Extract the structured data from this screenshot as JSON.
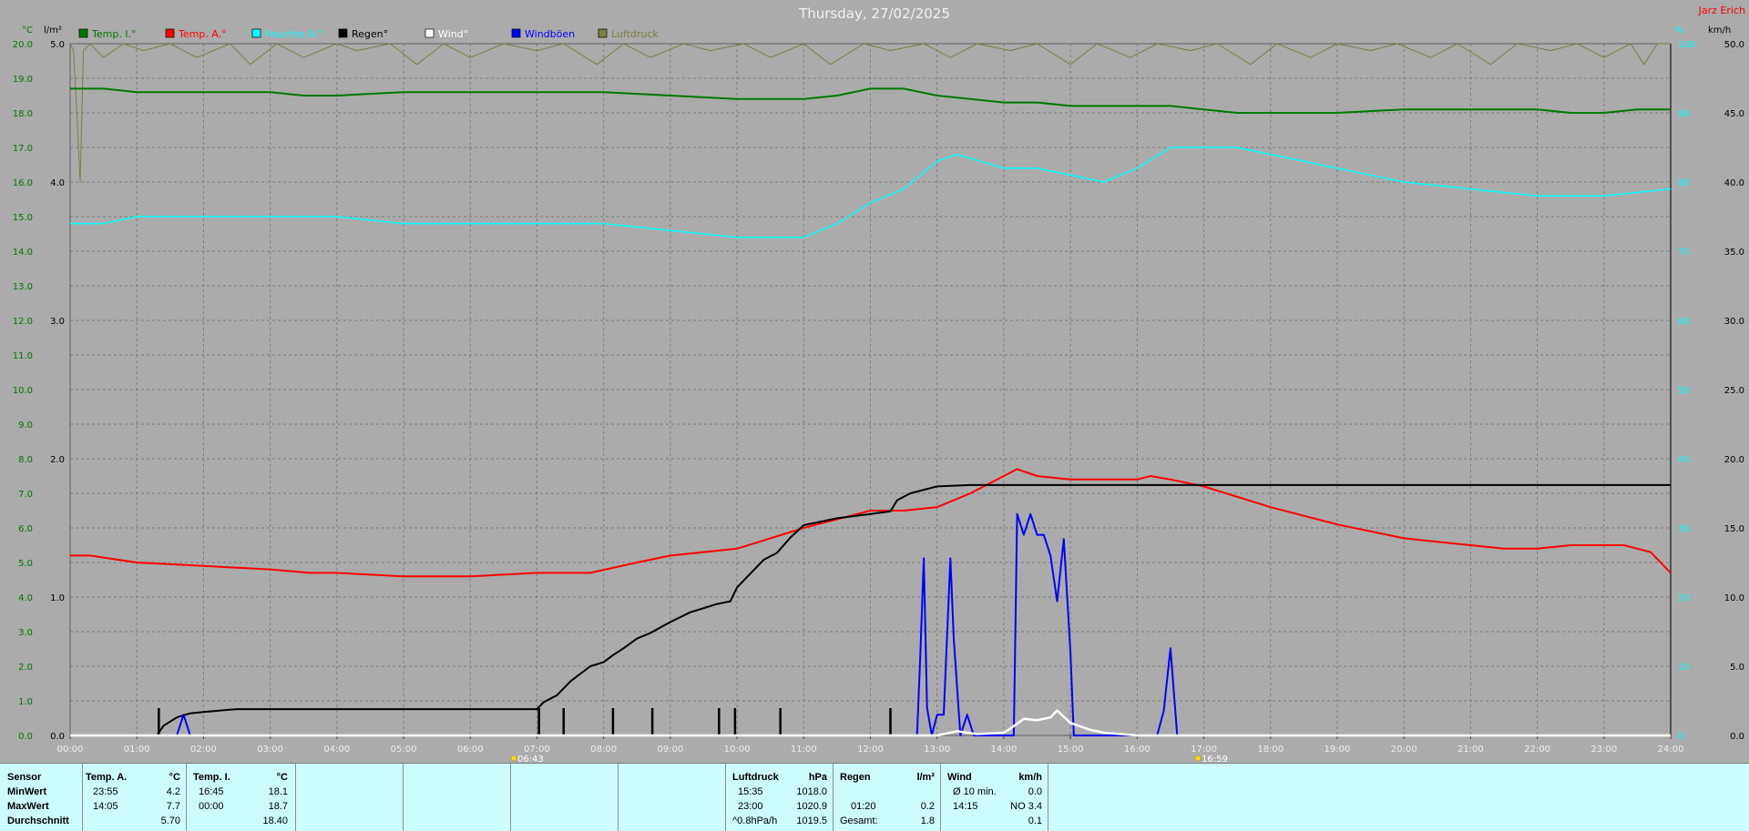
{
  "header": {
    "title": "Thursday, 27/02/2025",
    "station": "Jarz Erich"
  },
  "colors": {
    "temp_in": "#007800",
    "temp_out": "#ff0000",
    "humidity": "#00ffff",
    "rain": "#000000",
    "wind": "#ffffff",
    "gust": "#0000ff",
    "pressure": "#7e7e46"
  },
  "chart_data": {
    "type": "line",
    "title": "Thursday, 27/02/2025",
    "x_ticks": [
      "00:00",
      "01:00",
      "02:00",
      "03:00",
      "04:00",
      "05:00",
      "06:00",
      "07:00",
      "08:00",
      "09:00",
      "10:00",
      "11:00",
      "12:00",
      "13:00",
      "14:00",
      "15:00",
      "16:00",
      "17:00",
      "18:00",
      "19:00",
      "20:00",
      "21:00",
      "22:00",
      "23:00",
      "24:00"
    ],
    "x_range_hours": [
      0,
      24
    ],
    "grid": true,
    "legend_position": "top-left",
    "y_axes": {
      "temperature": {
        "unit": "°C",
        "range": [
          0,
          20
        ],
        "ticks": [
          "0.0",
          "1.0",
          "2.0",
          "3.0",
          "4.0",
          "5.0",
          "6.0",
          "7.0",
          "8.0",
          "9.0",
          "10.0",
          "11.0",
          "12.0",
          "13.0",
          "14.0",
          "15.0",
          "16.0",
          "17.0",
          "18.0",
          "19.0",
          "20.0"
        ]
      },
      "rain": {
        "unit": "l/m²",
        "range": [
          0,
          5
        ],
        "ticks": [
          "0.0",
          "1.0",
          "2.0",
          "3.0",
          "4.0",
          "5.0"
        ]
      },
      "humidity": {
        "unit": "%",
        "range": [
          0,
          100
        ],
        "ticks": [
          "0",
          "10",
          "20",
          "30",
          "40",
          "50",
          "60",
          "70",
          "80",
          "90",
          "100"
        ]
      },
      "wind": {
        "unit": "km/h",
        "range": [
          0,
          50
        ],
        "ticks": [
          "0.0",
          "5.0",
          "10.0",
          "15.0",
          "20.0",
          "25.0",
          "30.0",
          "35.0",
          "40.0",
          "45.0",
          "50.0"
        ]
      }
    },
    "sun_markers": [
      {
        "time": 6.72,
        "label": "06:43"
      },
      {
        "time": 16.98,
        "label": "16:59"
      }
    ],
    "rain_ticks": [
      1.33,
      7.03,
      7.4,
      8.14,
      8.73,
      9.73,
      9.97,
      10.65,
      12.3
    ],
    "series": [
      {
        "key": "temp_in",
        "name": "Temp. I.°",
        "axis": "temperature",
        "color": "#007800",
        "x": [
          0,
          0.5,
          1,
          2,
          3,
          3.5,
          4,
          5,
          6,
          7,
          8,
          9,
          10,
          10.7,
          11,
          11.5,
          12,
          12.5,
          13,
          13.5,
          14,
          14.5,
          15,
          15.5,
          16,
          16.5,
          17,
          17.5,
          18,
          19,
          20,
          21,
          22,
          22.5,
          23,
          23.5,
          24
        ],
        "y": [
          18.7,
          18.7,
          18.6,
          18.6,
          18.6,
          18.5,
          18.5,
          18.6,
          18.6,
          18.6,
          18.6,
          18.5,
          18.4,
          18.4,
          18.4,
          18.5,
          18.7,
          18.7,
          18.5,
          18.4,
          18.3,
          18.3,
          18.2,
          18.2,
          18.2,
          18.2,
          18.1,
          18.0,
          18.0,
          18.0,
          18.1,
          18.1,
          18.1,
          18.0,
          18.0,
          18.1,
          18.1
        ]
      },
      {
        "key": "temp_out",
        "name": "Temp. A.°",
        "axis": "temperature",
        "color": "#ff0000",
        "x": [
          0,
          0.3,
          1,
          2,
          3,
          3.6,
          4,
          5,
          5.5,
          6,
          7,
          7.8,
          8.5,
          9,
          10,
          10.5,
          11,
          12,
          12.5,
          13,
          13.5,
          14,
          14.2,
          14.5,
          15,
          15.5,
          16,
          16.2,
          16.5,
          17,
          17.5,
          18,
          19,
          20,
          20.5,
          21,
          21.5,
          22,
          22.5,
          23,
          23.3,
          23.7,
          24
        ],
        "y": [
          5.2,
          5.2,
          5.0,
          4.9,
          4.8,
          4.7,
          4.7,
          4.6,
          4.6,
          4.6,
          4.7,
          4.7,
          5.0,
          5.2,
          5.4,
          5.7,
          6.0,
          6.5,
          6.5,
          6.6,
          7.0,
          7.5,
          7.7,
          7.5,
          7.4,
          7.4,
          7.4,
          7.5,
          7.4,
          7.2,
          6.9,
          6.6,
          6.1,
          5.7,
          5.6,
          5.5,
          5.4,
          5.4,
          5.5,
          5.5,
          5.5,
          5.3,
          4.7
        ]
      },
      {
        "key": "humidity",
        "name": "Feuchte A.°",
        "axis": "humidity",
        "color": "#00ffff",
        "x": [
          0,
          0.5,
          1,
          2,
          3,
          4,
          5,
          6,
          7,
          8,
          9,
          10,
          11,
          11.5,
          12,
          12.5,
          13,
          13.3,
          14,
          14.5,
          15,
          15.5,
          16,
          16.5,
          17,
          17.5,
          18,
          19,
          20,
          21,
          22,
          22.5,
          23,
          24
        ],
        "y": [
          74,
          74,
          75,
          75,
          75,
          75,
          74,
          74,
          74,
          74,
          73,
          72,
          72,
          74,
          77,
          79,
          83,
          84,
          82,
          82,
          81,
          80,
          82,
          85,
          85,
          85,
          84,
          82,
          80,
          79,
          78,
          78,
          78,
          79
        ]
      },
      {
        "key": "rain",
        "name": "Regen°",
        "axis": "rain",
        "color": "#000000",
        "x": [
          0,
          1.3,
          1.4,
          1.6,
          1.8,
          2.0,
          2.5,
          3,
          4,
          5,
          6,
          6.5,
          7.0,
          7.1,
          7.3,
          7.5,
          7.8,
          8.0,
          8.14,
          8.3,
          8.5,
          8.7,
          9.0,
          9.3,
          9.7,
          9.9,
          10.0,
          10.2,
          10.4,
          10.6,
          10.8,
          11.0,
          11.5,
          12.0,
          12.3,
          12.4,
          12.6,
          13.0,
          13.5,
          14.0,
          24
        ],
        "y": [
          0,
          0,
          0.07,
          0.13,
          0.16,
          0.17,
          0.19,
          0.19,
          0.19,
          0.19,
          0.19,
          0.19,
          0.19,
          0.24,
          0.29,
          0.39,
          0.5,
          0.53,
          0.58,
          0.63,
          0.7,
          0.74,
          0.82,
          0.89,
          0.95,
          0.97,
          1.07,
          1.17,
          1.27,
          1.32,
          1.43,
          1.52,
          1.57,
          1.6,
          1.62,
          1.7,
          1.75,
          1.8,
          1.81,
          1.81,
          1.81
        ]
      },
      {
        "key": "wind",
        "name": "Wind°",
        "axis": "wind",
        "color": "#ffffff",
        "x": [
          0,
          12.5,
          13.0,
          13.3,
          13.6,
          14.0,
          14.1,
          14.3,
          14.5,
          14.7,
          14.8,
          15.0,
          15.3,
          15.5,
          16.0,
          24
        ],
        "y": [
          0,
          0,
          0,
          0.3,
          0.1,
          0.2,
          0.5,
          1.2,
          1.1,
          1.3,
          1.8,
          0.9,
          0.4,
          0.2,
          0,
          0
        ]
      },
      {
        "key": "gust",
        "name": "Windböen",
        "axis": "wind",
        "color": "#0000ff",
        "x": [
          0,
          1.6,
          1.7,
          1.8,
          12.7,
          12.75,
          12.8,
          12.85,
          12.92,
          13.0,
          13.1,
          13.2,
          13.25,
          13.35,
          13.45,
          13.55,
          13.65,
          14.15,
          14.2,
          14.3,
          14.4,
          14.5,
          14.6,
          14.7,
          14.8,
          14.9,
          15.0,
          15.05,
          15.2,
          16.3,
          16.4,
          16.5,
          16.6,
          24
        ],
        "y": [
          0,
          0,
          1.5,
          0,
          0,
          6,
          12.8,
          2,
          0,
          1.5,
          1.5,
          12.8,
          7,
          0,
          1.5,
          0,
          0,
          0,
          16,
          14.5,
          16,
          14.5,
          14.5,
          13,
          9.7,
          14.2,
          6,
          0,
          0,
          0,
          1.8,
          6.3,
          0,
          0
        ]
      },
      {
        "key": "pressure",
        "name": "Luftdruck",
        "axis": "humidity",
        "color": "#7e7e46",
        "x": [
          0,
          0.05,
          0.1,
          0.15,
          0.2,
          0.3,
          0.5,
          0.8,
          1.1,
          1.5,
          1.9,
          2.4,
          2.7,
          3.1,
          3.5,
          4.0,
          4.3,
          4.8,
          5.2,
          5.6,
          6.0,
          6.5,
          7.0,
          7.4,
          7.9,
          8.3,
          8.7,
          9.2,
          9.6,
          10.1,
          10.5,
          11.0,
          11.4,
          11.9,
          12.3,
          12.8,
          13.2,
          13.6,
          14.1,
          14.5,
          15.0,
          15.4,
          15.9,
          16.3,
          16.8,
          17.2,
          17.7,
          18.1,
          18.6,
          19.0,
          19.5,
          19.9,
          20.4,
          20.8,
          21.3,
          21.7,
          22.2,
          22.6,
          23.0,
          23.4,
          23.6,
          23.8,
          24
        ],
        "y": [
          100,
          99,
          90,
          80,
          99,
          100,
          98,
          100,
          99,
          100,
          98,
          100,
          97,
          100,
          98,
          100,
          99,
          100,
          97,
          100,
          98,
          100,
          99,
          100,
          97,
          100,
          98,
          100,
          99,
          100,
          98,
          100,
          97,
          100,
          99,
          100,
          98,
          100,
          99,
          100,
          97,
          100,
          98,
          100,
          99,
          100,
          97,
          100,
          98,
          100,
          99,
          100,
          98,
          100,
          97,
          100,
          99,
          100,
          98,
          100,
          97,
          100,
          100
        ]
      }
    ]
  },
  "stats": {
    "row_labels": [
      "Sensor",
      "MinWert",
      "MaxWert",
      "Durchschnitt"
    ],
    "temp_out": {
      "header": "Temp. A.",
      "unit": "°C",
      "min_time": "23:55",
      "min": "4.2",
      "max_time": "14:05",
      "max": "7.7",
      "avg": "5.70"
    },
    "temp_in": {
      "header": "Temp. I.",
      "unit": "°C",
      "min_time": "16:45",
      "min": "18.1",
      "max_time": "00:00",
      "max": "18.7",
      "avg": "18.40"
    },
    "pressure": {
      "header": "Luftdruck",
      "unit": "hPa",
      "min_time": "15:35",
      "min": "1018.0",
      "max_time": "23:00",
      "max": "1020.9",
      "trend": "^0.8hPa/h",
      "avg": "1019.5"
    },
    "rain": {
      "header": "Regen",
      "unit": "l/m²",
      "max_time": "01:20",
      "max": "0.2",
      "total_label": "Gesamt:",
      "total": "1.8"
    },
    "wind": {
      "header": "Wind",
      "unit": "km/h",
      "avg_label": "Ø 10 min.",
      "avg10": "0.0",
      "max_time": "14:15",
      "max": "NO 3.4",
      "avg": "0.1"
    }
  }
}
